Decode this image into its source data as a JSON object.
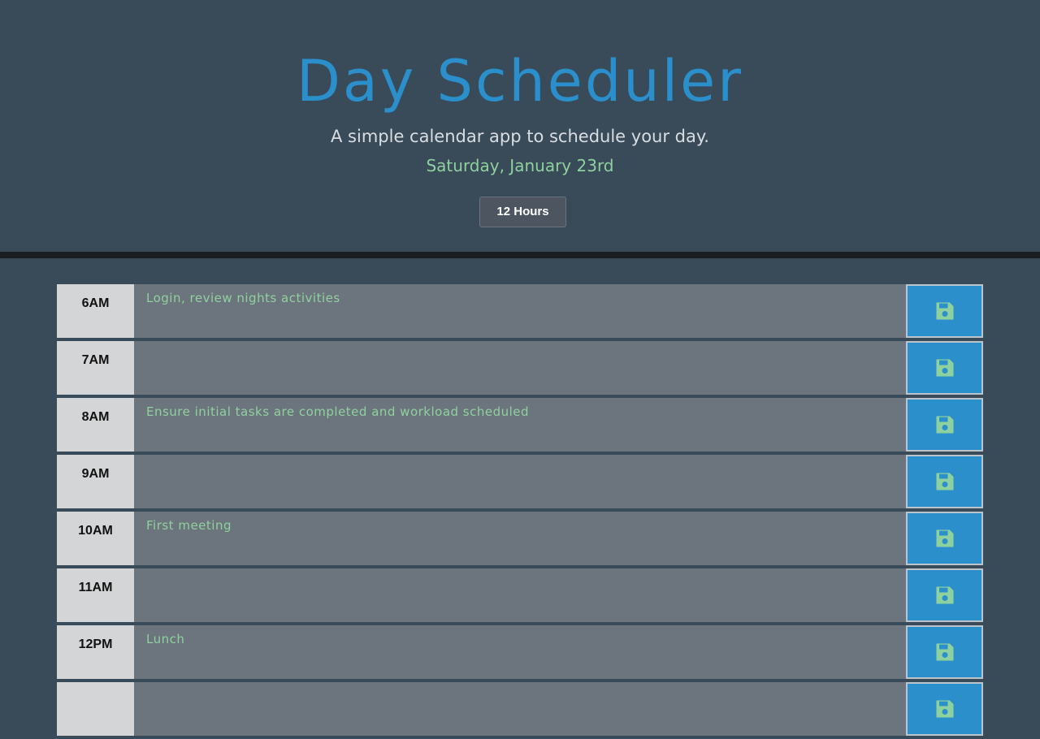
{
  "header": {
    "title": "Day Scheduler",
    "subtitle": "A simple calendar app to schedule your day.",
    "date": "Saturday, January 23rd",
    "toggle_label": "12 Hours"
  },
  "colors": {
    "accent": "#2b8fcb",
    "text_green": "#8fd19e",
    "hour_bg": "#d4d5d6",
    "row_bg": "#6c757d",
    "page_bg": "#394a59"
  },
  "schedule": {
    "rows": [
      {
        "hour": "6AM",
        "text": "Login, review nights activities",
        "icon": "save-icon"
      },
      {
        "hour": "7AM",
        "text": "",
        "icon": "save-icon"
      },
      {
        "hour": "8AM",
        "text": "Ensure initial tasks are completed and workload scheduled",
        "icon": "save-icon"
      },
      {
        "hour": "9AM",
        "text": "",
        "icon": "save-icon"
      },
      {
        "hour": "10AM",
        "text": "First meeting",
        "icon": "save-icon"
      },
      {
        "hour": "11AM",
        "text": "",
        "icon": "save-icon"
      },
      {
        "hour": "12PM",
        "text": "Lunch",
        "icon": "save-icon"
      },
      {
        "hour": "",
        "text": "",
        "icon": "save-icon"
      }
    ]
  }
}
